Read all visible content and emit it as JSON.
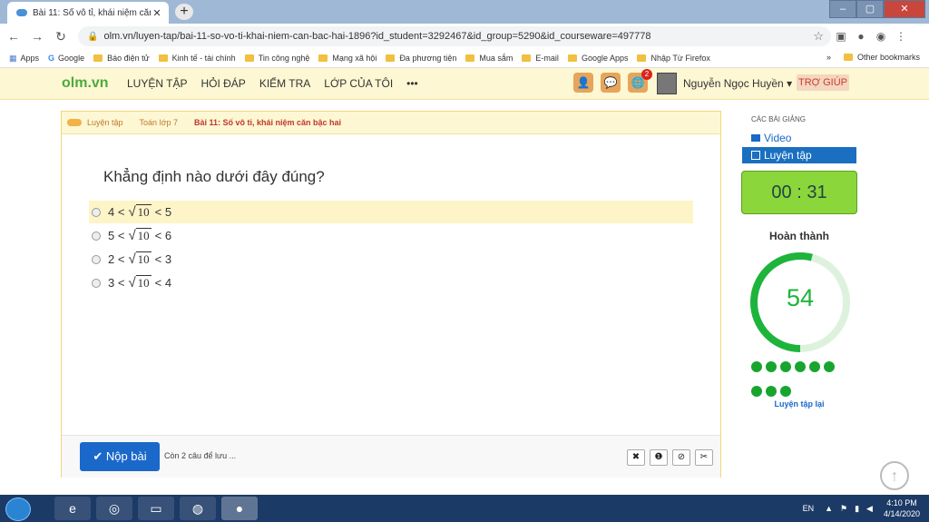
{
  "browser": {
    "tab_title": "Bài 11: Số vô tỉ, khái niệm căn bậc hai",
    "tab_close": "✕",
    "new_tab": "+",
    "url": "olm.vn/luyen-tap/bai-11-so-vo-ti-khai-niem-can-bac-hai-1896?id_student=3292467&id_group=5290&id_courseware=497778",
    "window_buttons": {
      "minimize": "–",
      "maximize": "▢",
      "close": "✕"
    }
  },
  "bookmarks": {
    "apps": "Apps",
    "items": [
      "Google",
      "Báo điện tử",
      "Kinh tế - tài chính",
      "Tin công nghệ",
      "Mạng xã hội",
      "Đa phương tiện",
      "Mua sắm",
      "E-mail",
      "Google Apps",
      "Nhập Từ Firefox"
    ],
    "more": "»",
    "other": "Other bookmarks"
  },
  "site": {
    "logo": "olm.vn",
    "nav": [
      "LUYỆN TẬP",
      "HỎI ĐÁP",
      "KIỂM TRA",
      "LỚP CỦA TÔI",
      "•••"
    ],
    "notification_count": "2",
    "user_name": "Nguyễn Ngọc Huyền ▾",
    "help": "TRỢ GIÚP"
  },
  "breadcrumb": [
    "Luyện tập",
    "Toán lớp 7",
    "Bài 11: Số vô tỉ, khái niệm căn bậc hai"
  ],
  "question": {
    "text": "Khẳng định nào dưới đây đúng?",
    "options": [
      {
        "left": "4 <",
        "radicand": "10",
        "right": "< 5"
      },
      {
        "left": "5 <",
        "radicand": "10",
        "right": "< 6"
      },
      {
        "left": "2 <",
        "radicand": "10",
        "right": "< 3"
      },
      {
        "left": "3 <",
        "radicand": "10",
        "right": "< 4"
      }
    ]
  },
  "footer": {
    "submit": "✔ Nộp bài",
    "save_hint": "Còn 2 câu để lưu ...",
    "tools": [
      "✖",
      "❶",
      "⊘",
      "✂"
    ]
  },
  "sidebar": {
    "heading": "CÁC BÀI GIẢNG",
    "video": "Video",
    "practice": "Luyện tập",
    "timer": "00 : 31",
    "completion_title": "Hoàn thành",
    "completion_value": "54",
    "completion_fraction": 0.54,
    "dots_count": 9,
    "retry": "Luyện tập lại"
  },
  "taskbar": {
    "lang": "EN",
    "time": "4:10 PM",
    "date": "4/14/2020"
  }
}
